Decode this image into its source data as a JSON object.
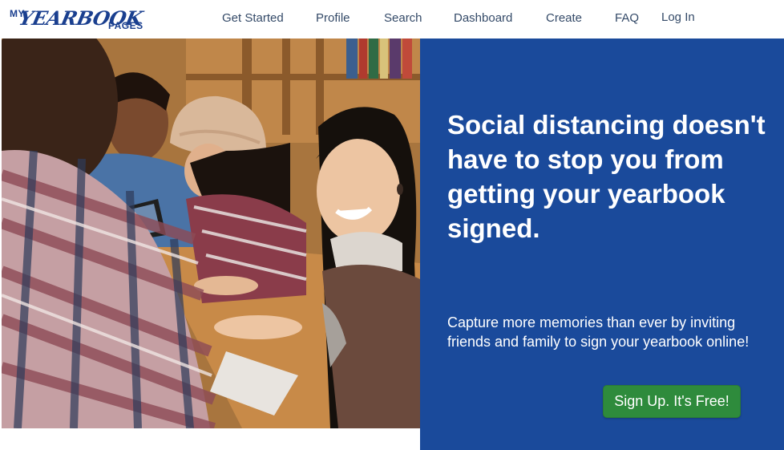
{
  "brand": {
    "logo_my": "MY",
    "logo_yearbook": "YEARBOOK",
    "logo_pages": "PAGES"
  },
  "nav": {
    "items": [
      {
        "label": "Get Started"
      },
      {
        "label": "Profile"
      },
      {
        "label": "Search"
      },
      {
        "label": "Dashboard"
      },
      {
        "label": "Create"
      },
      {
        "label": "FAQ"
      },
      {
        "label": "Log In"
      }
    ]
  },
  "hero": {
    "headline": "Social distancing doesn't have to stop you from getting your yearbook signed.",
    "subtext": "Capture more memories than ever by inviting friends and family to sign your yearbook online!",
    "cta_label": "Sign Up. It's Free!"
  },
  "colors": {
    "panel_blue": "#1a4a9b",
    "cta_green": "#2e8b3c",
    "nav_text": "#344a68",
    "logo_blue": "#1a3f8f"
  }
}
